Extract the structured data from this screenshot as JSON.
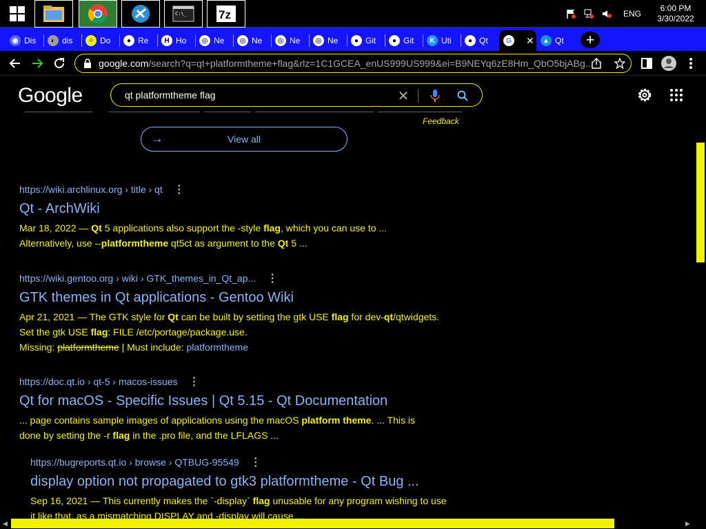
{
  "taskbar": {
    "clock_time": "6:00 PM",
    "clock_date": "3/30/2022",
    "language": "ENG"
  },
  "tabs": [
    {
      "title": "Dis",
      "icon": "discord-icon"
    },
    {
      "title": "dis",
      "icon": "globe-icon"
    },
    {
      "title": "Do",
      "icon": "dots-icon"
    },
    {
      "title": "Re",
      "icon": "github-icon"
    },
    {
      "title": "Ho",
      "icon": "h-icon"
    },
    {
      "title": "Ne",
      "icon": "chrome-icon"
    },
    {
      "title": "Ne",
      "icon": "chrome-icon"
    },
    {
      "title": "Ne",
      "icon": "chrome-icon"
    },
    {
      "title": "Ne",
      "icon": "chrome-icon"
    },
    {
      "title": "Git",
      "icon": "github-icon"
    },
    {
      "title": "Git",
      "icon": "github-icon"
    },
    {
      "title": "Uti",
      "icon": "kde-icon"
    },
    {
      "title": "Qt",
      "icon": "github-icon"
    },
    {
      "title": "",
      "icon": "google-icon"
    },
    {
      "title": "Qt",
      "icon": "arch-icon"
    }
  ],
  "address": {
    "host": "google.com",
    "path": "/search?q=qt+platformtheme+flag&rlz=1C1GCEA_enUS999US999&ei=B9NEYq6zE8Hm_QbO5bjABg..."
  },
  "google": {
    "logo": "Google",
    "query": "qt platformtheme flag",
    "feedback": "Feedback",
    "view_all": "View all"
  },
  "results": [
    {
      "url": "https://wiki.archlinux.org › title › qt",
      "title": "Qt - ArchWiki",
      "line1": [
        "Mar 18, 2022 — ",
        "Qt",
        " 5 applications also support the -style ",
        "flag",
        ", which you can use to ..."
      ],
      "line2": [
        "Alternatively, use --",
        "platformtheme",
        " qt5ct as argument to the ",
        "Qt",
        " 5 ..."
      ]
    },
    {
      "url": "https://wiki.gentoo.org › wiki › GTK_themes_in_Qt_ap...",
      "title": "GTK themes in Qt applications - Gentoo Wiki",
      "line1": [
        "Apr 21, 2021 — The GTK style for ",
        "Qt",
        " can be built by setting the gtk USE ",
        "flag",
        " for dev-",
        "qt",
        "/qtwidgets."
      ],
      "line2": [
        "Set the gtk USE ",
        "flag",
        ": FILE /etc/portage/package.use."
      ],
      "line3": [
        "Missing: ",
        "platformtheme",
        " | Must include: ",
        "platformtheme"
      ]
    },
    {
      "url": "https://doc.qt.io › qt-5 › macos-issues",
      "title": "Qt for macOS - Specific Issues | Qt 5.15 - Qt Documentation",
      "line1": [
        "... page contains sample images of applications using the macOS ",
        "platform theme",
        ". ... This is"
      ],
      "line2": [
        "done by setting the -r ",
        "flag",
        " in the .pro file, and the LFLAGS ..."
      ]
    },
    {
      "url": "https://bugreports.qt.io › browse › QTBUG-95549",
      "title": "display option not propagated to gtk3 platformtheme - Qt Bug ...",
      "line1": [
        "Sep 16, 2021 — This currently makes the `-display` ",
        "flag",
        " unusable for any program wishing to use"
      ],
      "line2": [
        "it like that, as a mismatching DISPLAY and -display will cause ..."
      ]
    }
  ],
  "colors": {
    "accent": "#f2f200",
    "link": "#8ab4f8",
    "tabstrip": "#1414ff"
  }
}
